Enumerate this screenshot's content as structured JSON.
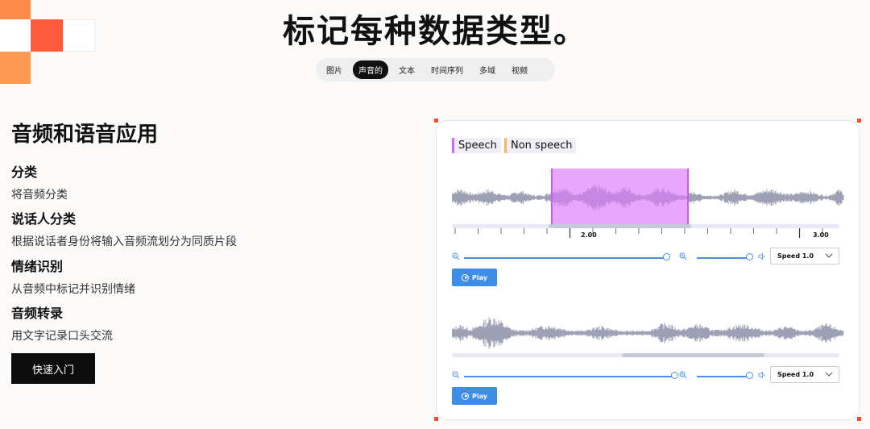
{
  "header": {
    "title": "标记每种数据类型。"
  },
  "tabs": [
    {
      "label": "图片",
      "active": false
    },
    {
      "label": "声音的",
      "active": true
    },
    {
      "label": "文本",
      "active": false
    },
    {
      "label": "时间序列",
      "active": false
    },
    {
      "label": "多域",
      "active": false
    },
    {
      "label": "视频",
      "active": false
    }
  ],
  "section": {
    "title": "音频和语音应用",
    "features": [
      {
        "title": "分类",
        "desc": "将音频分类"
      },
      {
        "title": "说话人分类",
        "desc": "根据说话者身份将输入音频流划分为同质片段"
      },
      {
        "title": "情绪识别",
        "desc": "从音频中标记并识别情绪"
      },
      {
        "title": "音频转录",
        "desc": "用文字记录口头交流"
      }
    ],
    "cta_label": "快速入门"
  },
  "player": {
    "labels": [
      {
        "text": "Speech",
        "color": "#d36bf0"
      },
      {
        "text": "Non speech",
        "color": "#f5b66b"
      }
    ],
    "tick_labels": [
      "2.00",
      "3.00"
    ],
    "speed_label": "Speed 1.0",
    "play_label": "Play",
    "accent": "#4a90e2",
    "wave_color": "#9ea0b5"
  }
}
